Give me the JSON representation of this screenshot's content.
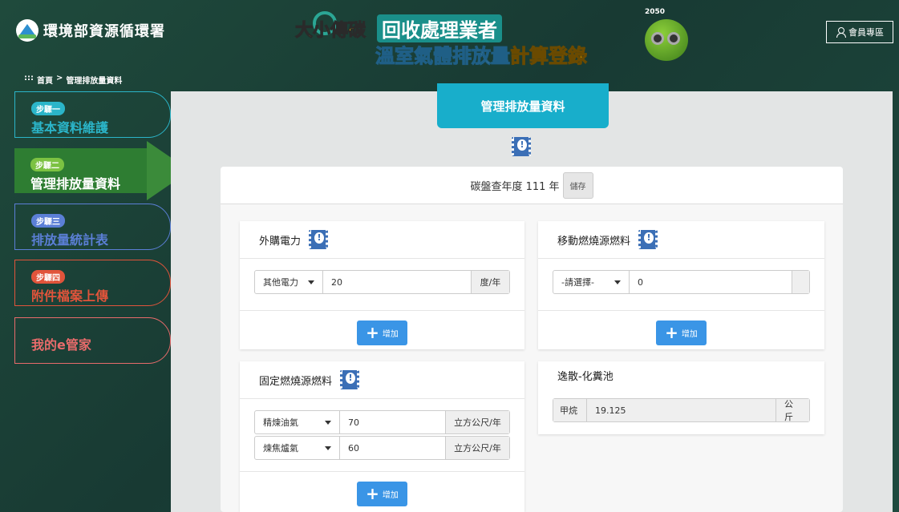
{
  "header": {
    "logo_text": "環境部資源循環署",
    "banner_line1_a": "大小傳碳",
    "banner_line1_b": "回收處理業者",
    "banner_line2_a": "溫室氣體排放量",
    "banner_line2_b": "計算登錄",
    "mascot_badge": "2050",
    "member_button": "會員專區"
  },
  "breadcrumb": {
    "prefix": ":::",
    "home": "首頁",
    "sep": ">",
    "current": "管理排放量資料"
  },
  "steps": [
    {
      "tag": "步驟一",
      "title": "基本資料維護"
    },
    {
      "tag": "步驟二",
      "title": "管理排放量資料"
    },
    {
      "tag": "步驟三",
      "title": "排放量統計表"
    },
    {
      "tag": "步驟四",
      "title": "附件檔案上傳"
    },
    {
      "title": "我的e管家"
    }
  ],
  "main": {
    "tab_title": "管理排放量資料",
    "year_label": "碳盤查年度 111 年",
    "save_button": "儲存"
  },
  "sections": {
    "purchased_power": {
      "title": "外購電力",
      "rows": [
        {
          "select": "其他電力",
          "value": "20",
          "unit": "度/年"
        }
      ],
      "add_button": "增加"
    },
    "mobile_fuel": {
      "title": "移動燃燒源燃料",
      "rows": [
        {
          "select": "-請選擇-",
          "value": "0",
          "unit": ""
        }
      ],
      "add_button": "增加"
    },
    "stationary_fuel": {
      "title": "固定燃燒源燃料",
      "rows": [
        {
          "select": "精煉油氣",
          "value": "70",
          "unit": "立方公尺/年"
        },
        {
          "select": "煉焦爐氣",
          "value": "60",
          "unit": "立方公尺/年"
        }
      ],
      "add_button": "增加"
    },
    "septic": {
      "title": "逸散-化糞池",
      "rows": [
        {
          "label": "甲烷",
          "value": "19.125",
          "unit": "公斤"
        }
      ]
    }
  },
  "colors": {
    "step1": "#2bb5c9",
    "step2": "#2e7d32",
    "step3": "#5b7fd6",
    "step4": "#e1543b",
    "step5": "#e86b6b",
    "tab": "#18aecb",
    "add_button": "#3a95e6"
  }
}
